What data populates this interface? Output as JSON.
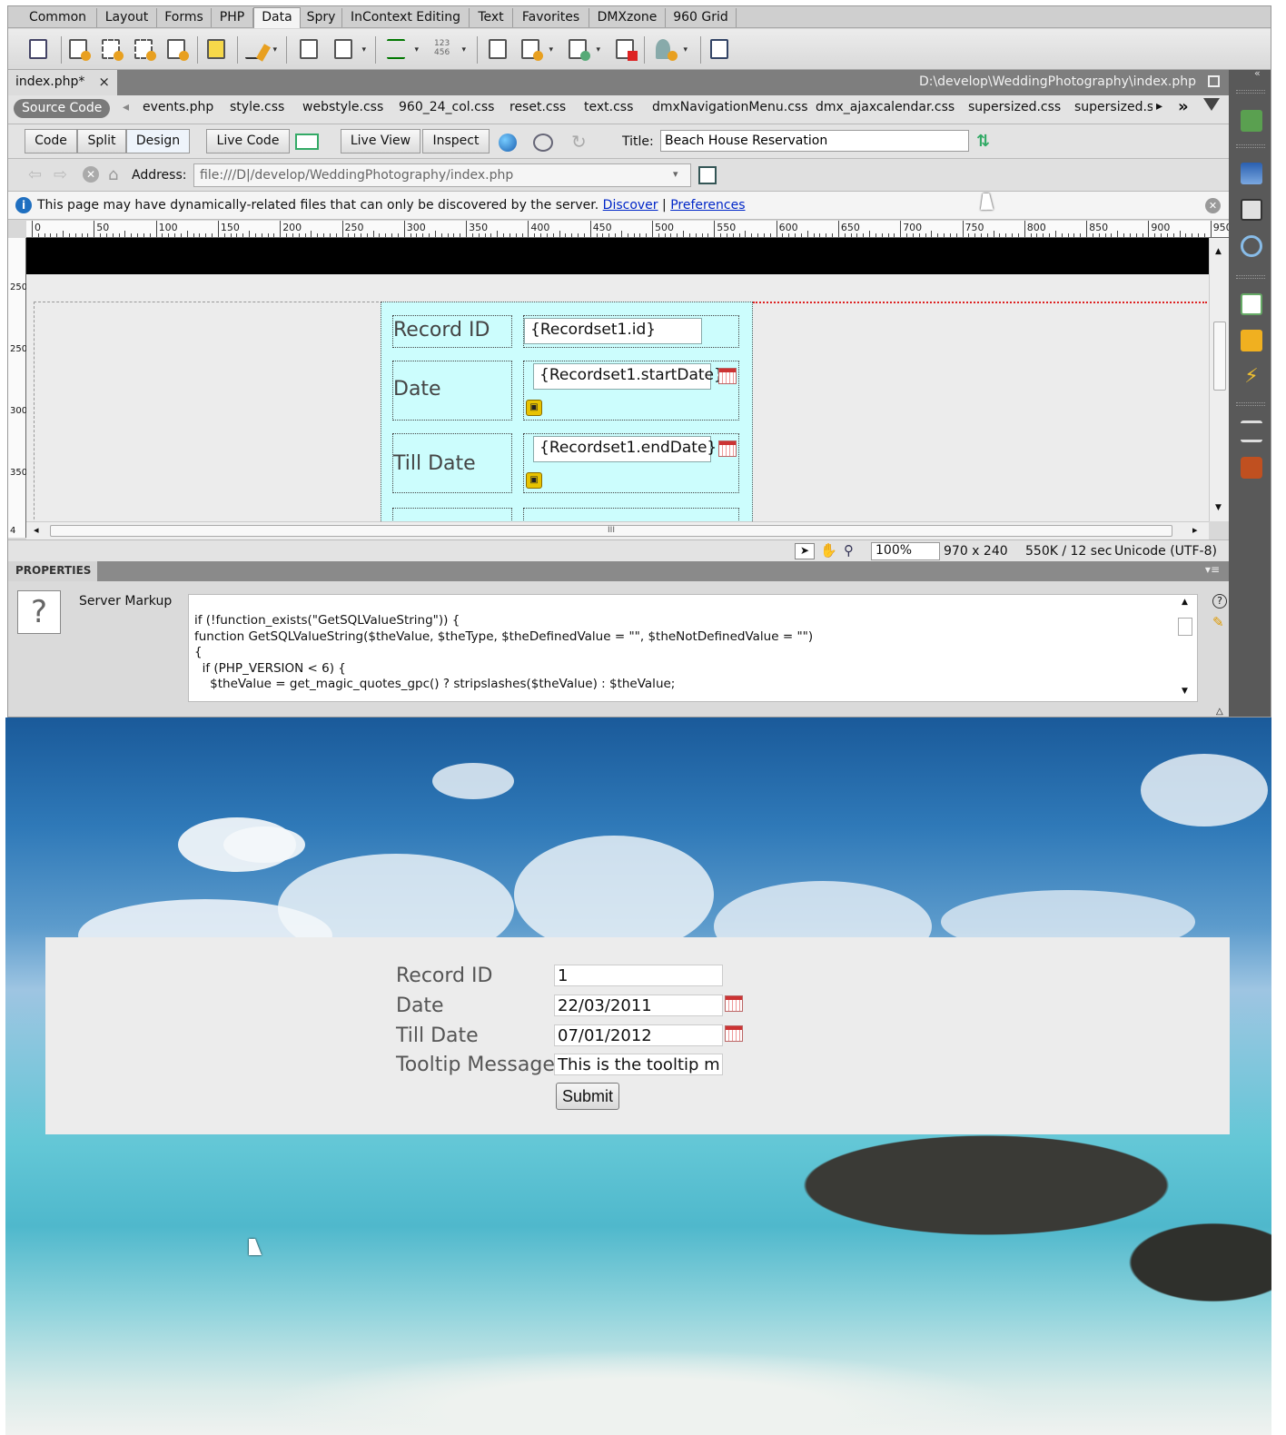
{
  "insert_bar": {
    "tabs": [
      {
        "label": "Common"
      },
      {
        "label": "Layout"
      },
      {
        "label": "Forms"
      },
      {
        "label": "PHP"
      },
      {
        "label": "Data",
        "active": true
      },
      {
        "label": "Spry"
      },
      {
        "label": "InContext Editing"
      },
      {
        "label": "Text"
      },
      {
        "label": "Favorites"
      },
      {
        "label": "DMXzone"
      },
      {
        "label": "960 Grid"
      }
    ]
  },
  "document": {
    "tab_label": "index.php*",
    "close_glyph": "×",
    "path": "D:\\develop\\WeddingPhotography\\index.php"
  },
  "related_files": {
    "source_code": "Source Code",
    "files": [
      "events.php",
      "style.css",
      "webstyle.css",
      "960_24_col.css",
      "reset.css",
      "text.css",
      "dmxNavigationMenu.css",
      "dmx_ajaxcalendar.css",
      "supersized.css",
      "supersized.s"
    ]
  },
  "doc_toolbar": {
    "code": "Code",
    "split": "Split",
    "design": "Design",
    "live_code": "Live Code",
    "live_view": "Live View",
    "inspect": "Inspect",
    "title_label": "Title:",
    "title_value": "Beach House Reservation"
  },
  "address_bar": {
    "label": "Address:",
    "value": "file:///D|/develop/WeddingPhotography/index.php"
  },
  "info_bar": {
    "message": "This page may have dynamically-related files that can only be discovered by the server.",
    "discover": "Discover",
    "separator": "|",
    "preferences": "Preferences"
  },
  "ruler": {
    "labels": [
      "0",
      "50",
      "100",
      "150",
      "200",
      "250",
      "300",
      "350",
      "400",
      "450",
      "500",
      "550",
      "600",
      "650",
      "700",
      "750",
      "800",
      "850",
      "900",
      "950"
    ],
    "v_labels": [
      "250",
      "250",
      "300",
      "350",
      "4"
    ]
  },
  "design_view": {
    "record_id_label": "Record ID",
    "record_id_field": "{Recordset1.id}",
    "date_label": "Date",
    "date_field": "{Recordset1.startDate}",
    "till_date_label": "Till Date",
    "till_date_field": "{Recordset1.endDate}",
    "hscroll_grip": "III"
  },
  "status_bar": {
    "zoom": "100%",
    "dimensions": "970 x 240",
    "size": "550K / 12 sec",
    "encoding": "Unicode (UTF-8)"
  },
  "properties": {
    "title": "PROPERTIES",
    "help_glyph": "?",
    "server_markup_label": "Server Markup",
    "code": "if (!function_exists(\"GetSQLValueString\")) {\nfunction GetSQLValueString($theValue, $theType, $theDefinedValue = \"\", $theNotDefinedValue = \"\")\n{\n  if (PHP_VERSION < 6) {\n    $theValue = get_magic_quotes_gpc() ? stripslashes($theValue) : $theValue;"
  },
  "browser_form": {
    "record_id_label": "Record ID",
    "record_id_value": "1",
    "date_label": "Date",
    "date_value": "22/03/2011",
    "till_date_label": "Till Date",
    "till_date_value": "07/01/2012",
    "tooltip_label": "Tooltip Message",
    "tooltip_value": "This is the tooltip mess",
    "submit_label": "Submit"
  },
  "colors": {
    "form_highlight": "#ccfdfd",
    "link": "#0026c8",
    "panel_dark": "#595959"
  }
}
